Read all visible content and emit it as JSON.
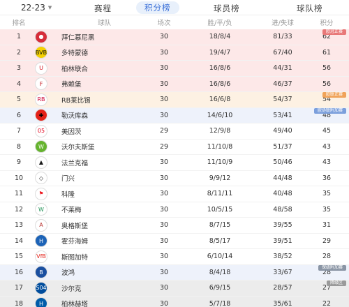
{
  "season": {
    "label": "22-23"
  },
  "tabs": [
    {
      "label": "赛程"
    },
    {
      "label": "积分榜"
    },
    {
      "label": "球员榜"
    },
    {
      "label": "球队榜"
    }
  ],
  "columns": {
    "rank": "排名",
    "team": "球队",
    "played": "场次",
    "wdl": "胜/平/负",
    "goals": "进/失球",
    "points": "积分"
  },
  "zone_tags": {
    "ucl": "欧冠正赛",
    "uel": "欧联正赛",
    "uecl": "欧协联附加赛",
    "playoff": "保级附加赛",
    "relegation": "降级区"
  },
  "colors": {
    "accent": "#3a6fd8",
    "ucl": "#e87878",
    "uel": "#f0a35a",
    "uecl": "#7b9fdc",
    "relegation": "#9a9a9a"
  },
  "rows": [
    {
      "rank": "1",
      "team": "拜仁慕尼黑",
      "played": "30",
      "wdl": "18/8/4",
      "goals": "81/33",
      "points": "62",
      "zone": "ucl",
      "logo_bg": "#d62e3a",
      "logo_fg": "#ffffff",
      "logo_icon": "bayern-logo",
      "logo_glyph": "●"
    },
    {
      "rank": "2",
      "team": "多特蒙德",
      "played": "30",
      "wdl": "19/4/7",
      "goals": "67/40",
      "points": "61",
      "zone": "ucl",
      "logo_bg": "#f5d000",
      "logo_fg": "#111111",
      "logo_icon": "dortmund-logo",
      "logo_glyph": "BVB"
    },
    {
      "rank": "3",
      "team": "柏林联合",
      "played": "30",
      "wdl": "16/8/6",
      "goals": "44/31",
      "points": "56",
      "zone": "ucl",
      "logo_bg": "#ffffff",
      "logo_fg": "#d4141e",
      "logo_icon": "union-berlin-logo",
      "logo_glyph": "U"
    },
    {
      "rank": "4",
      "team": "弗赖堡",
      "played": "30",
      "wdl": "16/8/6",
      "goals": "46/37",
      "points": "56",
      "zone": "ucl",
      "logo_bg": "#ffffff",
      "logo_fg": "#c4161c",
      "logo_icon": "freiburg-logo",
      "logo_glyph": "F"
    },
    {
      "rank": "5",
      "team": "RB莱比锡",
      "played": "30",
      "wdl": "16/6/8",
      "goals": "54/37",
      "points": "54",
      "zone": "uel",
      "logo_bg": "#ffffff",
      "logo_fg": "#cc0033",
      "logo_icon": "leipzig-logo",
      "logo_glyph": "RB"
    },
    {
      "rank": "6",
      "team": "勒沃库森",
      "played": "30",
      "wdl": "14/6/10",
      "goals": "53/41",
      "points": "48",
      "zone": "uecl",
      "logo_bg": "#e32219",
      "logo_fg": "#000000",
      "logo_icon": "leverkusen-logo",
      "logo_glyph": "✚"
    },
    {
      "rank": "7",
      "team": "美因茨",
      "played": "29",
      "wdl": "12/9/8",
      "goals": "49/40",
      "points": "45",
      "zone": "",
      "logo_bg": "#ffffff",
      "logo_fg": "#e2001a",
      "logo_icon": "mainz-logo",
      "logo_glyph": "05"
    },
    {
      "rank": "8",
      "team": "沃尔夫斯堡",
      "played": "29",
      "wdl": "11/10/8",
      "goals": "51/37",
      "points": "43",
      "zone": "",
      "logo_bg": "#65b32e",
      "logo_fg": "#ffffff",
      "logo_icon": "wolfsburg-logo",
      "logo_glyph": "W"
    },
    {
      "rank": "9",
      "team": "法兰克福",
      "played": "30",
      "wdl": "11/10/9",
      "goals": "50/46",
      "points": "43",
      "zone": "",
      "logo_bg": "#ffffff",
      "logo_fg": "#1a1a1a",
      "logo_icon": "frankfurt-logo",
      "logo_glyph": "▲"
    },
    {
      "rank": "10",
      "team": "门兴",
      "played": "30",
      "wdl": "9/9/12",
      "goals": "44/48",
      "points": "36",
      "zone": "",
      "logo_bg": "#ffffff",
      "logo_fg": "#222222",
      "logo_icon": "gladbach-logo",
      "logo_glyph": "◇"
    },
    {
      "rank": "11",
      "team": "科隆",
      "played": "30",
      "wdl": "8/11/11",
      "goals": "40/48",
      "points": "35",
      "zone": "",
      "logo_bg": "#ffffff",
      "logo_fg": "#ed1c24",
      "logo_icon": "koln-logo",
      "logo_glyph": "⚑"
    },
    {
      "rank": "12",
      "team": "不莱梅",
      "played": "30",
      "wdl": "10/5/15",
      "goals": "48/58",
      "points": "35",
      "zone": "",
      "logo_bg": "#ffffff",
      "logo_fg": "#1d9053",
      "logo_icon": "bremen-logo",
      "logo_glyph": "W"
    },
    {
      "rank": "13",
      "team": "奥格斯堡",
      "played": "30",
      "wdl": "8/7/15",
      "goals": "39/55",
      "points": "31",
      "zone": "",
      "logo_bg": "#ffffff",
      "logo_fg": "#ba3733",
      "logo_icon": "augsburg-logo",
      "logo_glyph": "A"
    },
    {
      "rank": "14",
      "team": "霍芬海姆",
      "played": "30",
      "wdl": "8/5/17",
      "goals": "39/51",
      "points": "29",
      "zone": "",
      "logo_bg": "#1c63b7",
      "logo_fg": "#ffffff",
      "logo_icon": "hoffenheim-logo",
      "logo_glyph": "H"
    },
    {
      "rank": "15",
      "team": "斯图加特",
      "played": "30",
      "wdl": "6/10/14",
      "goals": "38/52",
      "points": "28",
      "zone": "",
      "logo_bg": "#ffffff",
      "logo_fg": "#e32219",
      "logo_icon": "stuttgart-logo",
      "logo_glyph": "VfB"
    },
    {
      "rank": "16",
      "team": "波鸿",
      "played": "30",
      "wdl": "8/4/18",
      "goals": "33/67",
      "points": "28",
      "zone": "uecl",
      "logo_bg": "#1a4fa0",
      "logo_fg": "#ffffff",
      "logo_icon": "bochum-logo",
      "logo_glyph": "B"
    },
    {
      "rank": "17",
      "team": "沙尔克",
      "played": "30",
      "wdl": "6/9/15",
      "goals": "28/57",
      "points": "27",
      "zone": "relegation",
      "logo_bg": "#004d9d",
      "logo_fg": "#ffffff",
      "logo_icon": "schalke-logo",
      "logo_glyph": "S04"
    },
    {
      "rank": "18",
      "team": "柏林赫塔",
      "played": "30",
      "wdl": "5/7/18",
      "goals": "35/61",
      "points": "22",
      "zone": "relegation",
      "logo_bg": "#005ca9",
      "logo_fg": "#ffffff",
      "logo_icon": "hertha-logo",
      "logo_glyph": "H"
    }
  ]
}
